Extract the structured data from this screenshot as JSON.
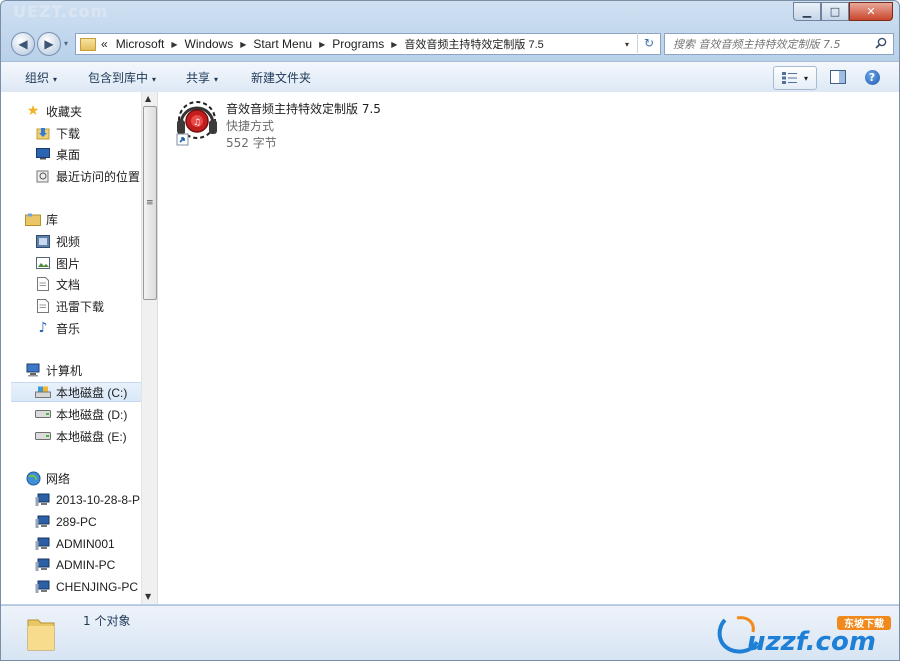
{
  "watermark_top": "UEZT.com",
  "caption": {
    "minimize": "▁",
    "maximize": "□",
    "close": "✕"
  },
  "nav_buttons": {
    "back": "◀",
    "forward": "▶",
    "history": "▾"
  },
  "address": {
    "overflow": "«",
    "crumbs": [
      "Microsoft",
      "Windows",
      "Start Menu",
      "Programs",
      "音效音频主持特效定制版 7.5"
    ],
    "separator": "▶",
    "dropdown": "▾",
    "refresh": "↻"
  },
  "search": {
    "placeholder": "搜索 音效音频主持特效定制版 7.5",
    "icon": "search-icon"
  },
  "toolbar": {
    "organize": "组织",
    "include_in_library": "包含到库中",
    "share": "共享",
    "new_folder": "新建文件夹",
    "arrow": "▾",
    "help": "?"
  },
  "nav": {
    "favorites": {
      "title": "收藏夹",
      "items": [
        "下载",
        "桌面",
        "最近访问的位置"
      ]
    },
    "libraries": {
      "title": "库",
      "items": [
        "视频",
        "图片",
        "文档",
        "迅雷下载",
        "音乐"
      ]
    },
    "computer": {
      "title": "计算机",
      "items": [
        "本地磁盘 (C:)",
        "本地磁盘 (D:)",
        "本地磁盘 (E:)"
      ],
      "selected_index": 0
    },
    "network": {
      "title": "网络",
      "items": [
        "2013-10-28-8-P",
        "289-PC",
        "ADMIN001",
        "ADMIN-PC",
        "CHENJING-PC"
      ]
    }
  },
  "file": {
    "name": "音效音频主持特效定制版 7.5",
    "type": "快捷方式",
    "size": "552 字节"
  },
  "status": {
    "count": "1 个对象"
  },
  "logo": {
    "text": "uzzf.com",
    "badge": "东坡下载"
  },
  "colors": {
    "accent": "#1e7fd6",
    "logo_orange": "#f08a1c",
    "selection": "#d9e8f8"
  }
}
